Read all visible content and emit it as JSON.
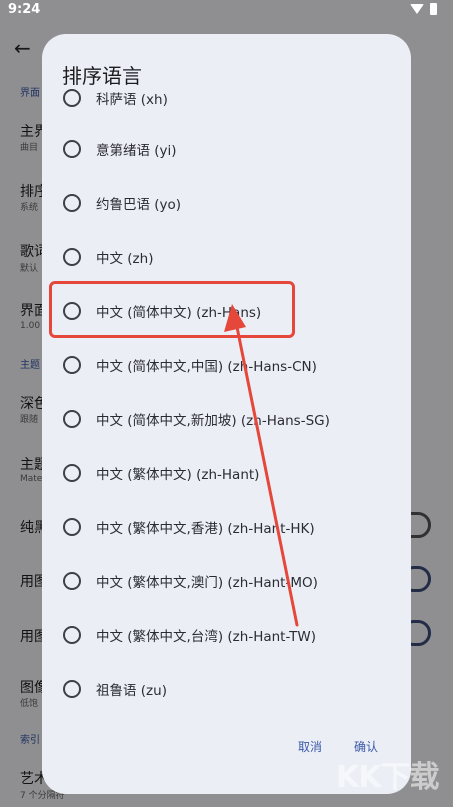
{
  "status": {
    "time": "9:24"
  },
  "dialog": {
    "title": "排序语言",
    "options": [
      {
        "label": "科萨语 (xh)",
        "selected": false
      },
      {
        "label": "意第绪语 (yi)",
        "selected": false
      },
      {
        "label": "约鲁巴语 (yo)",
        "selected": false
      },
      {
        "label": "中文 (zh)",
        "selected": false
      },
      {
        "label": "中文 (简体中文) (zh-Hans)",
        "selected": false
      },
      {
        "label": "中文 (简体中文,中国) (zh-Hans-CN)",
        "selected": false
      },
      {
        "label": "中文 (简体中文,新加坡) (zh-Hans-SG)",
        "selected": false
      },
      {
        "label": "中文 (繁体中文) (zh-Hant)",
        "selected": false
      },
      {
        "label": "中文 (繁体中文,香港) (zh-Hant-HK)",
        "selected": false
      },
      {
        "label": "中文 (繁体中文,澳门) (zh-Hant-MO)",
        "selected": false
      },
      {
        "label": "中文 (繁体中文,台湾) (zh-Hant-TW)",
        "selected": false
      },
      {
        "label": "祖鲁语 (zu)",
        "selected": false
      }
    ],
    "cancel_label": "取消",
    "confirm_label": "确认"
  },
  "background": {
    "items": [
      {
        "text": "界面"
      },
      {
        "text": "主界"
      },
      {
        "text": "曲目"
      },
      {
        "text": "排序"
      },
      {
        "text": "系统"
      },
      {
        "text": "歌词"
      },
      {
        "text": "默认"
      },
      {
        "text": "界面"
      },
      {
        "text": "1.00"
      },
      {
        "text": "主题"
      },
      {
        "text": "深色"
      },
      {
        "text": "跟随"
      },
      {
        "text": "主题"
      },
      {
        "text": "Mate"
      },
      {
        "text": "纯黑"
      },
      {
        "text": "用图"
      },
      {
        "text": "用图"
      },
      {
        "text": "图像"
      },
      {
        "text": "低饱"
      },
      {
        "text": "索引"
      },
      {
        "text": "艺术"
      },
      {
        "text": "7 个分隔符"
      }
    ]
  },
  "watermark": "KK下载",
  "colors": {
    "highlight": "#e5473a",
    "accent": "#3b5aa8"
  }
}
